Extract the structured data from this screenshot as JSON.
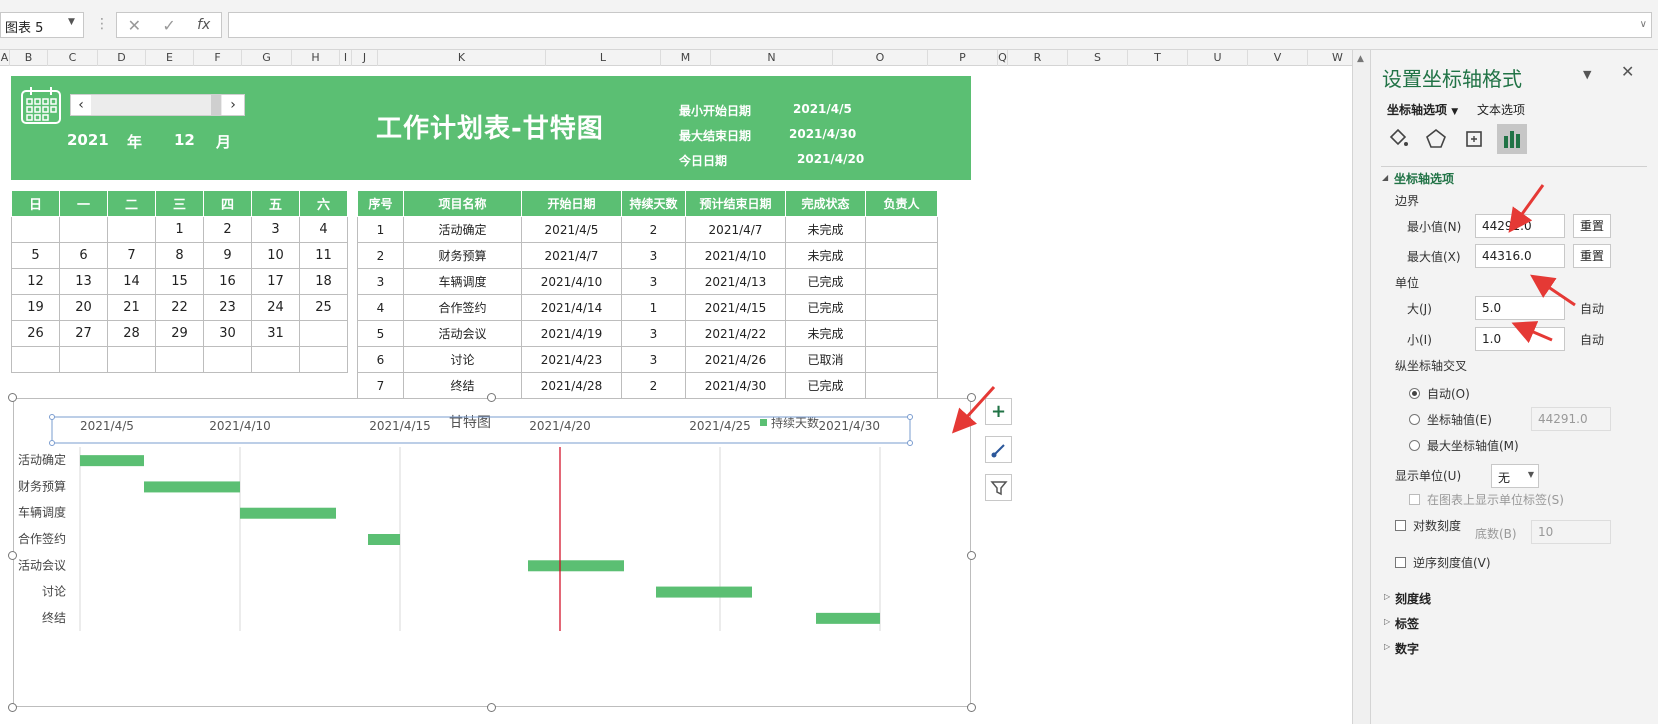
{
  "formula_bar": {
    "name_box": "图表 5",
    "cancel_glyph": "✕",
    "enter_glyph": "✓",
    "fx_label": "fx",
    "formula": ""
  },
  "columns": [
    "A",
    "B",
    "C",
    "D",
    "E",
    "F",
    "G",
    "H",
    "I",
    "J",
    "K",
    "L",
    "M",
    "N",
    "O",
    "P",
    "Q",
    "R",
    "S",
    "T",
    "U",
    "V",
    "W"
  ],
  "banner": {
    "year": "2021",
    "year_unit": "年",
    "month": "12",
    "month_unit": "月",
    "title": "工作计划表-甘特图",
    "info": [
      {
        "label": "最小开始日期",
        "value": "2021/4/5"
      },
      {
        "label": "最大结束日期",
        "value": "2021/4/30"
      },
      {
        "label": "今日日期",
        "value": "2021/4/20"
      }
    ]
  },
  "calendar": {
    "headers": [
      "日",
      "一",
      "二",
      "三",
      "四",
      "五",
      "六"
    ],
    "rows": [
      [
        "",
        "",
        "",
        "1",
        "2",
        "3",
        "4"
      ],
      [
        "5",
        "6",
        "7",
        "8",
        "9",
        "10",
        "11"
      ],
      [
        "12",
        "13",
        "14",
        "15",
        "16",
        "17",
        "18"
      ],
      [
        "19",
        "20",
        "21",
        "22",
        "23",
        "24",
        "25"
      ],
      [
        "26",
        "27",
        "28",
        "29",
        "30",
        "31",
        ""
      ],
      [
        "",
        "",
        "",
        "",
        "",
        "",
        ""
      ]
    ]
  },
  "tasks": {
    "headers": [
      "序号",
      "项目名称",
      "开始日期",
      "持续天数",
      "预计结束日期",
      "完成状态",
      "负责人"
    ],
    "rows": [
      [
        "1",
        "活动确定",
        "2021/4/5",
        "2",
        "2021/4/7",
        "未完成",
        ""
      ],
      [
        "2",
        "财务预算",
        "2021/4/7",
        "3",
        "2021/4/10",
        "未完成",
        ""
      ],
      [
        "3",
        "车辆调度",
        "2021/4/10",
        "3",
        "2021/4/13",
        "已完成",
        ""
      ],
      [
        "4",
        "合作签约",
        "2021/4/14",
        "1",
        "2021/4/15",
        "已完成",
        ""
      ],
      [
        "5",
        "活动会议",
        "2021/4/19",
        "3",
        "2021/4/22",
        "未完成",
        ""
      ],
      [
        "6",
        "讨论",
        "2021/4/23",
        "3",
        "2021/4/26",
        "已取消",
        ""
      ],
      [
        "7",
        "终结",
        "2021/4/28",
        "2",
        "2021/4/30",
        "已完成",
        ""
      ]
    ]
  },
  "chart_data": {
    "type": "bar",
    "orientation": "horizontal-gantt",
    "title": "甘特图",
    "legend": [
      "持续天数"
    ],
    "legend_position": "top-right",
    "x_axis_position": "top",
    "xlim": [
      44291,
      44316
    ],
    "major_unit": 5,
    "x_tick_labels": [
      "2021/4/5",
      "2021/4/10",
      "2021/4/15",
      "2021/4/20",
      "2021/4/25",
      "2021/4/30"
    ],
    "today_line": 44306,
    "categories": [
      "活动确定",
      "财务预算",
      "车辆调度",
      "合作签约",
      "活动会议",
      "讨论",
      "终结"
    ],
    "series": [
      {
        "name": "持续天数",
        "start": [
          44291,
          44293,
          44296,
          44300,
          44305,
          44309,
          44314
        ],
        "values": [
          2,
          3,
          3,
          1,
          3,
          3,
          2
        ]
      }
    ],
    "bar_color": "#5bbf73",
    "today_color": "#d0021b",
    "grid": true
  },
  "side_buttons": [
    {
      "name": "chart-elements-button",
      "glyph": "+"
    },
    {
      "name": "chart-styles-button",
      "glyph": "✎"
    },
    {
      "name": "chart-filters-button",
      "glyph": "⏷"
    }
  ],
  "panel": {
    "title": "设置坐标轴格式",
    "close": "✕",
    "tab_axis": "坐标轴选项",
    "tab_text": "文本选项",
    "section_axis": "坐标轴选项",
    "bounds": "边界",
    "min_label": "最小值(N)",
    "min_value": "44291.0",
    "max_label": "最大值(X)",
    "max_value": "44316.0",
    "reset": "重置",
    "units": "单位",
    "major_label": "大(J)",
    "major_value": "5.0",
    "minor_label": "小(I)",
    "minor_value": "1.0",
    "auto": "自动",
    "crosses": "纵坐标轴交叉",
    "cross_auto": "自动(O)",
    "cross_value_label": "坐标轴值(E)",
    "cross_value": "44291.0",
    "cross_max": "最大坐标轴值(M)",
    "display_units": "显示单位(U)",
    "display_units_value": "无",
    "show_units_label": "在图表上显示单位标签(S)",
    "log_scale": "对数刻度",
    "log_base_label": "底数(B)",
    "log_base": "10",
    "reverse": "逆序刻度值(V)",
    "sec_ticks": "刻度线",
    "sec_labels": "标签",
    "sec_number": "数字"
  }
}
